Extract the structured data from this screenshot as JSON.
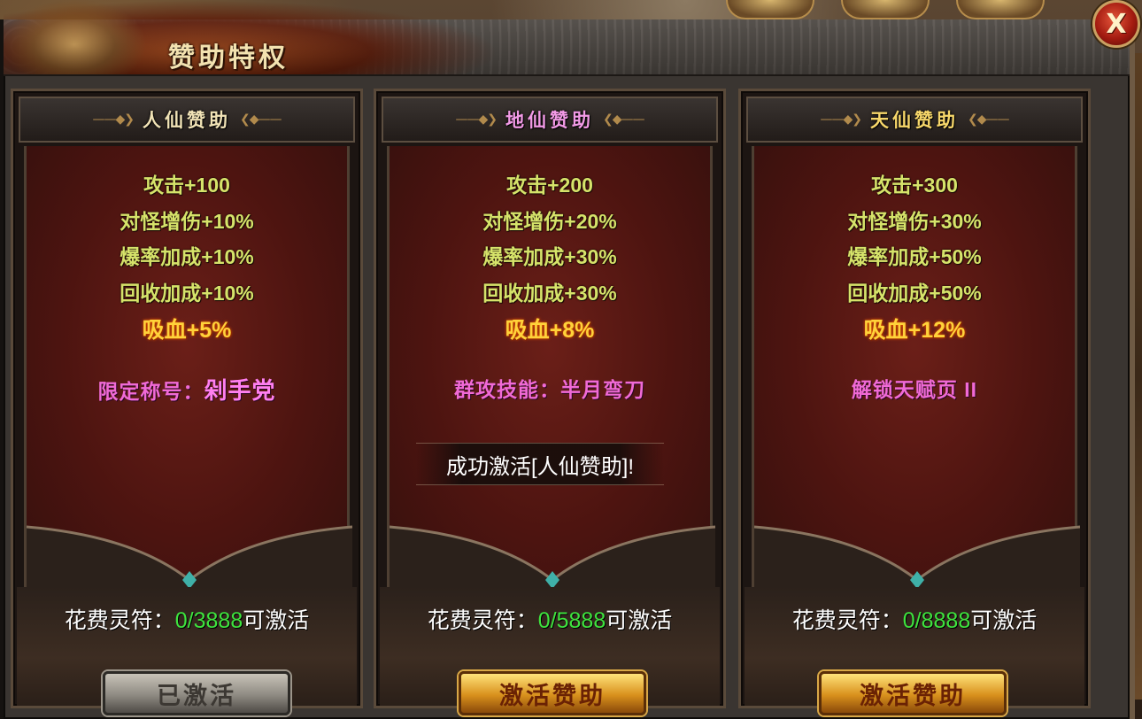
{
  "window": {
    "title": "赞助特权",
    "close_label": "X"
  },
  "panels": [
    {
      "title": "人仙赞助",
      "title_color": "#f1e3b6",
      "stats": [
        "攻击+100",
        "对怪增伤+10%",
        "爆率加成+10%",
        "回收加成+10%"
      ],
      "highlight": "吸血+5%",
      "perk_label": "限定称号：",
      "perk_value": "剁手党",
      "cost_label": "花费灵符：",
      "cost_value": "0/3888",
      "cost_suffix": "可激活",
      "button_label": "已激活",
      "button_state": "activated"
    },
    {
      "title": "地仙赞助",
      "title_color": "#f29ae6",
      "stats": [
        "攻击+200",
        "对怪增伤+20%",
        "爆率加成+30%",
        "回收加成+30%"
      ],
      "highlight": "吸血+8%",
      "perk_label": "群攻技能：半月弯刀",
      "perk_value": "",
      "cost_label": "花费灵符：",
      "cost_value": "0/5888",
      "cost_suffix": "可激活",
      "button_label": "激活赞助",
      "button_state": "available"
    },
    {
      "title": "天仙赞助",
      "title_color": "#f7d76a",
      "stats": [
        "攻击+300",
        "对怪增伤+30%",
        "爆率加成+50%",
        "回收加成+50%"
      ],
      "highlight": "吸血+12%",
      "perk_label": "解锁天赋页 II",
      "perk_value": "",
      "cost_label": "花费灵符：",
      "cost_value": "0/8888",
      "cost_suffix": "可激活",
      "button_label": "激活赞助",
      "button_state": "available"
    }
  ],
  "toast": {
    "message": "成功激活[人仙赞助]!"
  },
  "colors": {
    "stat_text": "#d6e36a",
    "highlight_text": "#ffd23a",
    "perk_text": "#f06ad6",
    "cost_value": "#3ee33e"
  }
}
